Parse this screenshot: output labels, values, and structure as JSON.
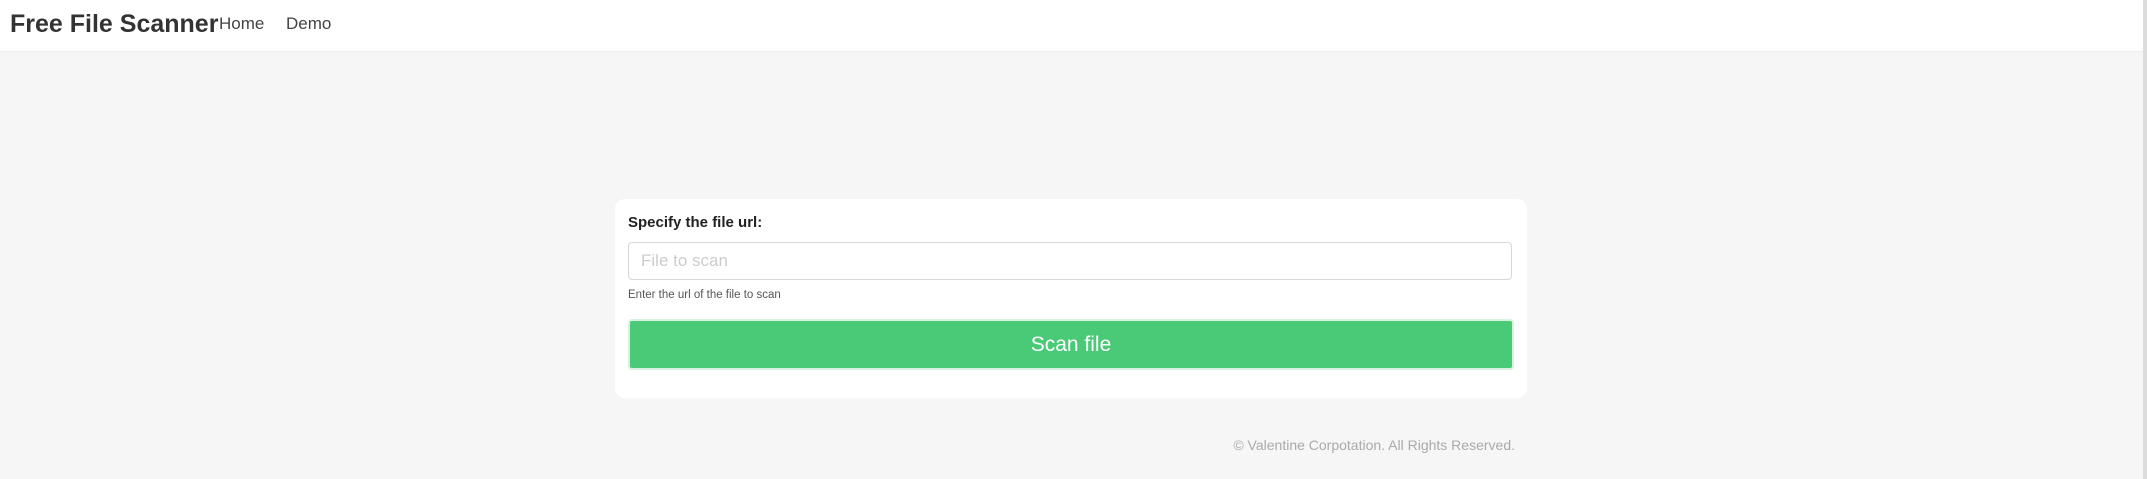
{
  "header": {
    "brand": "Free File Scanner",
    "nav": [
      "Home",
      "Demo"
    ]
  },
  "form": {
    "label": "Specify the file url:",
    "input_value": "",
    "input_placeholder": "File to scan",
    "help_text": "Enter the url of the file to scan",
    "submit_label": "Scan file"
  },
  "footer": {
    "copyright": "© Valentine Corpotation. All Rights Reserved."
  },
  "colors": {
    "accent": "#4ac977",
    "background": "#f6f6f6"
  }
}
